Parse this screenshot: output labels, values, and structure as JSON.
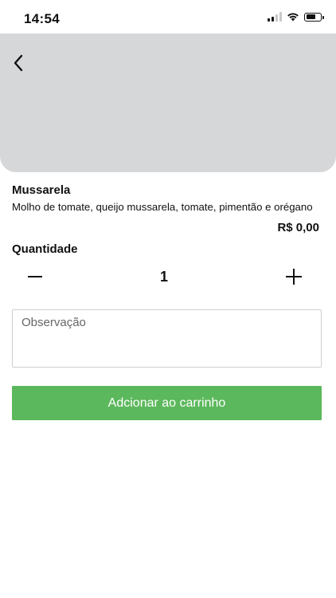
{
  "status_bar": {
    "time": "14:54",
    "icons": [
      "cellular-signal-icon",
      "wifi-icon",
      "battery-icon"
    ]
  },
  "header": {
    "back_icon": "chevron-left-icon",
    "image_placeholder_color": "#d6d7d9"
  },
  "product": {
    "name": "Mussarela",
    "description": "Molho de tomate, queijo mussarela, tomate, pimentão e orégano",
    "price": "R$ 0,00"
  },
  "quantity": {
    "label": "Quantidade",
    "value": "1",
    "decrement_icon": "minus-icon",
    "increment_icon": "plus-icon"
  },
  "note": {
    "placeholder": "Observação",
    "value": ""
  },
  "cart_button": {
    "label": "Adcionar ao carrinho",
    "color": "#5cb85c"
  }
}
